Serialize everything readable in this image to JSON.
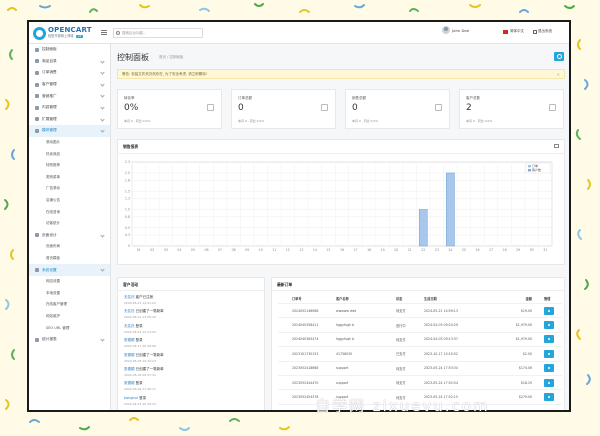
{
  "header": {
    "brand": "OPENCART",
    "brand_sub": "轻型开源网上商城",
    "brand_badge": "v4",
    "search_placeholder": "搜索后台功能...",
    "user_name": "John Doe",
    "language": "简体中文",
    "logout": "退出系统"
  },
  "sidebar": {
    "items": [
      {
        "label": "控制面板",
        "caret": false
      },
      {
        "label": "商品目录",
        "caret": true
      },
      {
        "label": "订单销售",
        "caret": true
      },
      {
        "label": "客户管理",
        "caret": true
      },
      {
        "label": "营销推广",
        "caret": true
      },
      {
        "label": "内容管理",
        "caret": true
      },
      {
        "label": "扩展管理",
        "caret": true
      },
      {
        "label": "模块管理",
        "caret": true,
        "active": true
      }
    ],
    "sub1": [
      "滚动图片",
      "热卖商品",
      "特别推荐",
      "类别菜单",
      "广告滚动",
      "店铺公告",
      "在线咨询",
      "访客统计"
    ],
    "items2": [
      {
        "label": "页面设计",
        "caret": true
      }
    ],
    "sub2": [
      "页面布局",
      "首页模板"
    ],
    "items3": [
      {
        "label": "系统设置",
        "caret": true,
        "active": true
      }
    ],
    "sub3": [
      "网店设置",
      "本地设置",
      "在线客户管理",
      "网站维护",
      "SEO URL 管理"
    ],
    "items4": [
      {
        "label": "统计报表",
        "caret": true
      }
    ]
  },
  "page": {
    "title": "控制面板",
    "breadcrumb": "首页 / 控制面板",
    "alert": "警告: 安装文件夹仍然存在, 为了安全考虑, 请立即删除!"
  },
  "tiles": [
    {
      "label": "转化率",
      "value": "0%",
      "sub": "本月 0 · 同比 0.0%",
      "icon": "user-icon"
    },
    {
      "label": "订单总额",
      "value": "0",
      "sub": "本月 0 · 同比 0.0%",
      "icon": "cart-icon"
    },
    {
      "label": "销售总额",
      "value": "0",
      "sub": "本月 0 · 同比 0.0%",
      "icon": "box-icon"
    },
    {
      "label": "客户总数",
      "value": "2",
      "sub": "本月 0 · 同比 0.0%",
      "icon": "users-icon"
    }
  ],
  "chart_data": {
    "type": "bar",
    "title": "销售报表",
    "categories": [
      "01",
      "02",
      "03",
      "04",
      "05",
      "06",
      "07",
      "08",
      "09",
      "10",
      "11",
      "12",
      "13",
      "14",
      "15",
      "16",
      "17",
      "18",
      "19",
      "20",
      "21",
      "22",
      "23",
      "24",
      "25",
      "26",
      "27",
      "28",
      "29",
      "30",
      "31"
    ],
    "series": [
      {
        "name": "订单",
        "values": [
          0,
          0,
          0,
          0,
          0,
          0,
          0,
          0,
          0,
          0,
          0,
          0,
          0,
          0,
          0,
          0,
          0,
          0,
          0,
          0,
          0,
          0,
          0,
          0,
          0,
          0,
          0,
          0,
          0,
          0,
          0
        ]
      },
      {
        "name": "客户数",
        "values": [
          0,
          0,
          0,
          0,
          0,
          0,
          0,
          0,
          0,
          0,
          0,
          0,
          0,
          0,
          0,
          0,
          0,
          0,
          0,
          0,
          0,
          1,
          0,
          2,
          0,
          0,
          0,
          0,
          0,
          0,
          0
        ]
      }
    ],
    "yticks": [
      "0",
      "0.3",
      "0.5",
      "0.8",
      "1.0",
      "1.3",
      "1.5",
      "1.8",
      "2.0",
      "2.3"
    ],
    "ylim": [
      0,
      2.3
    ],
    "grid": true,
    "legend": "top-right",
    "colors": {
      "orders": "#9dc6ea",
      "customers": "#7fa8d8"
    }
  },
  "activity": {
    "title": "客户活动",
    "items": [
      {
        "name": "无名氏",
        "action": "客户已注册",
        "date": "2024-05-21 14:01:22"
      },
      {
        "name": "无名氏",
        "action": "已创建了一笔新单",
        "date": "2024-05-21 13:05:40"
      },
      {
        "name": "无名氏",
        "action": "登录",
        "date": "2024-05-21 12:11:03"
      },
      {
        "name": "张德顺",
        "action": "登录",
        "date": "2024-05-17 10:29:08"
      },
      {
        "name": "张德顺",
        "action": "已创建了一笔新单",
        "date": "2024-05-03 10:32:24"
      },
      {
        "name": "张德顺",
        "action": "已创建了一笔新单",
        "date": "2024-05-03 09:47:31"
      },
      {
        "name": "张德顺",
        "action": "登录",
        "date": "2024-05-02 17:36:11"
      },
      {
        "name": "kanghui",
        "action": "登录",
        "date": "2024-04-23 16:44:10"
      }
    ]
  },
  "orders": {
    "title": "最新订单",
    "headers": [
      "订单号",
      "客户名称",
      "状态",
      "生成日期",
      "金额",
      "管理"
    ],
    "rows": [
      {
        "id": "2024052146068",
        "customer": "wwwww ddd",
        "status": "待支付",
        "date": "2024-05-21 14:59:13",
        "total": "$19.00"
      },
      {
        "id": "2024040358411",
        "customer": "hggyfugh b",
        "status": "进行中",
        "date": "2024-04-03 09:24:29",
        "total": "$1,979.00"
      },
      {
        "id": "2024040363474",
        "customer": "hggyfugh b",
        "status": "待支付",
        "date": "2024-04-03 09:13:37",
        "total": "$1,979.00"
      },
      {
        "id": "2023101730153",
        "customer": "41758030",
        "status": "已支付",
        "date": "2023-10-17 10:10:52",
        "total": "$2.00"
      },
      {
        "id": "2023052418668",
        "customer": "support",
        "status": "待支付",
        "date": "2023-05-24 17:53:34",
        "total": "$174.06"
      },
      {
        "id": "2023052444470",
        "customer": "support",
        "status": "待支付",
        "date": "2023-05-24 17:52:54",
        "total": "$18.25"
      },
      {
        "id": "2023052454378",
        "customer": "support",
        "status": "待支付",
        "date": "2023-05-24 17:52:15",
        "total": "$279.00"
      }
    ]
  },
  "watermark": "自学网 zixuevu.com"
}
